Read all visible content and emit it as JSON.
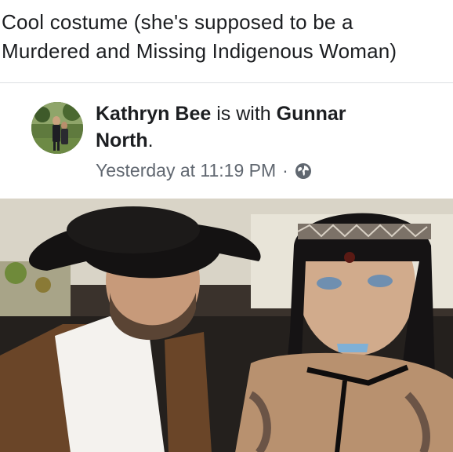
{
  "caption": {
    "line1": "Cool costume (she's supposed to be a",
    "line2": "Murdered and Missing Indigenous Woman)"
  },
  "post": {
    "author": "Kathryn Bee",
    "connector": "is with",
    "tagged_first": "Gunnar",
    "tagged_second": "North",
    "tagged_punct": ".",
    "time_text": "Yesterday at 11:19 PM",
    "separator": "·",
    "privacy_icon": "globe-icon"
  },
  "colors": {
    "text_primary": "#1c1e21",
    "text_secondary": "#606770",
    "divider": "#dddfe2"
  }
}
